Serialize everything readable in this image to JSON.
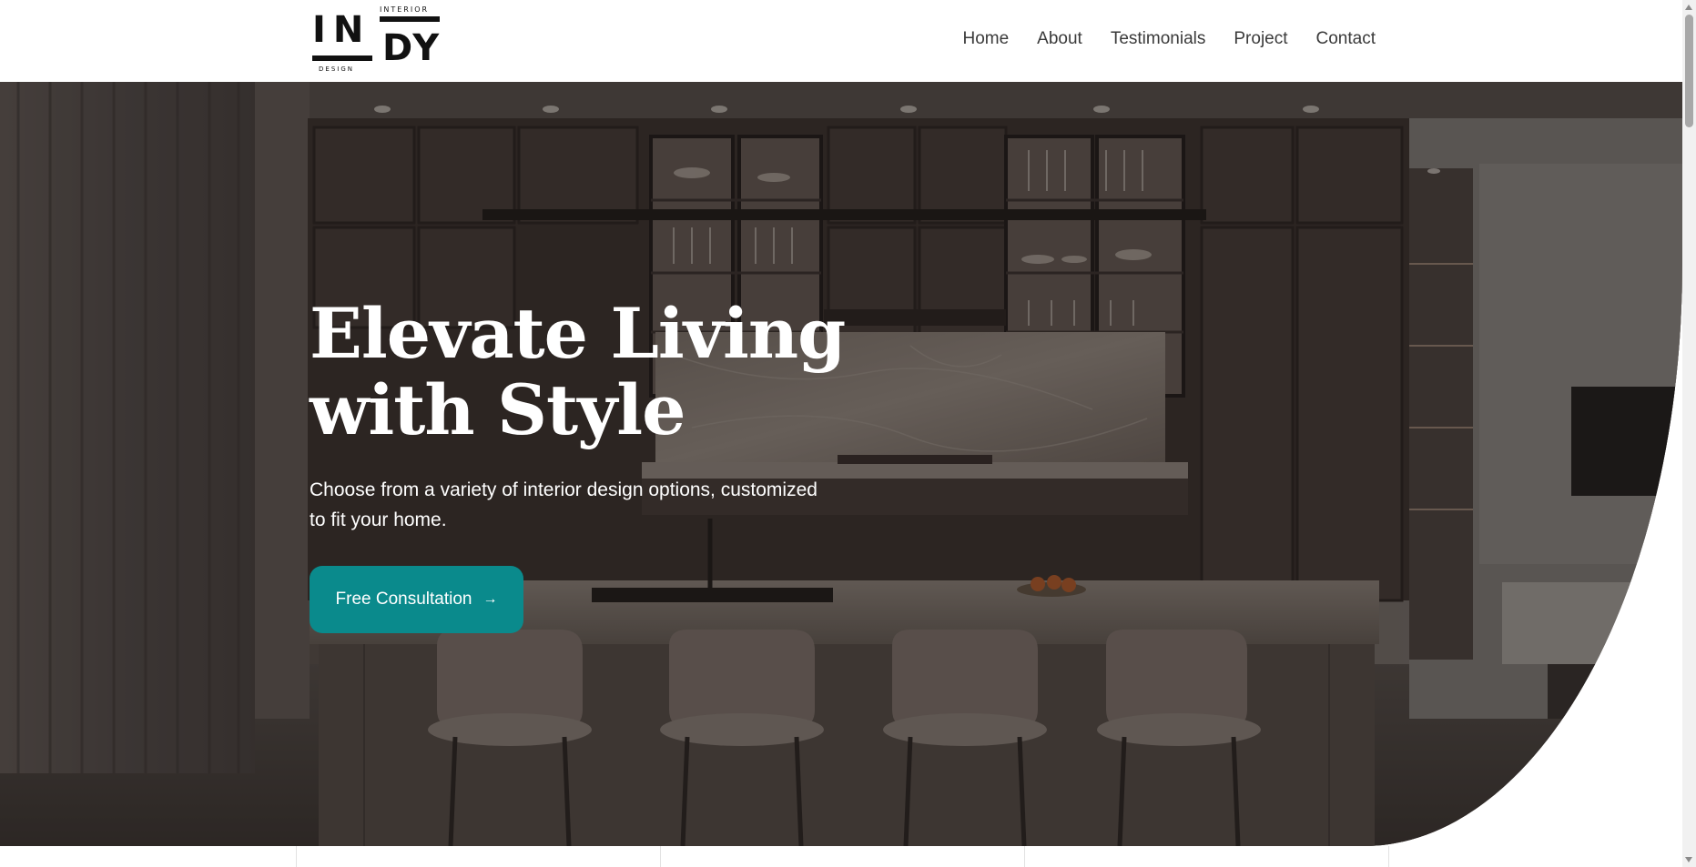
{
  "header": {
    "logo": {
      "top_text": "INTERIOR",
      "main_left": "IN",
      "main_right": "DY",
      "bottom_text": "DESIGN"
    },
    "nav": [
      {
        "label": "Home"
      },
      {
        "label": "About"
      },
      {
        "label": "Testimonials"
      },
      {
        "label": "Project"
      },
      {
        "label": "Contact"
      }
    ]
  },
  "hero": {
    "title": "Elevate Living with Style",
    "subtitle": "Choose from a variety of interior design options, customized to fit your home.",
    "cta_label": "Free Consultation",
    "cta_icon": "arrow-right-icon",
    "cta_color": "#0a8a8c"
  }
}
